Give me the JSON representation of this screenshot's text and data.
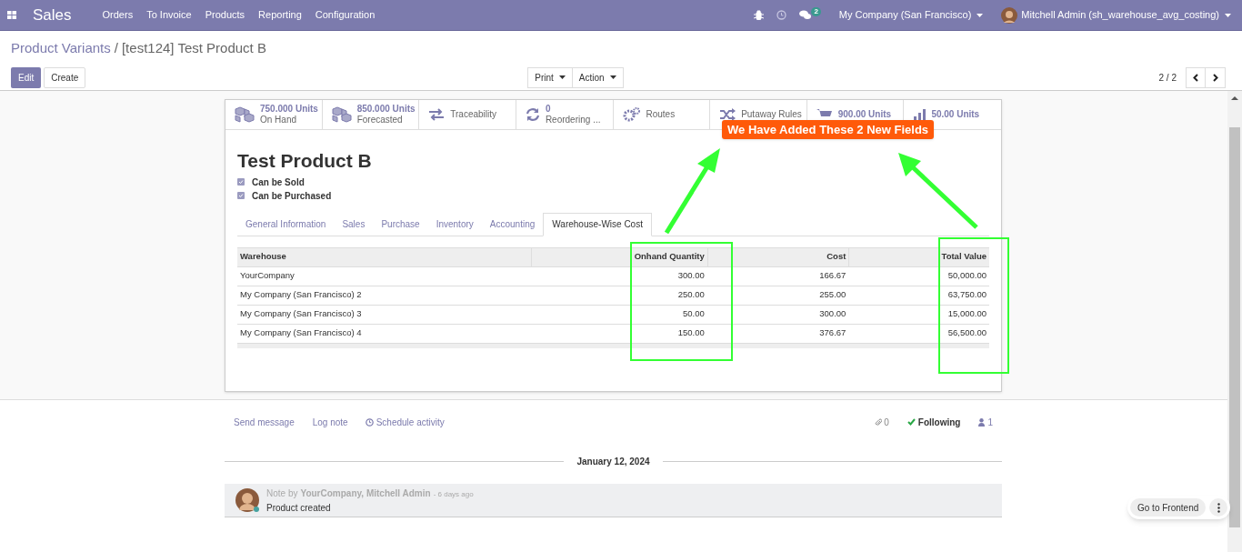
{
  "navbar": {
    "app": "Sales",
    "menu": [
      "Orders",
      "To Invoice",
      "Products",
      "Reporting",
      "Configuration"
    ],
    "messages_count": "2",
    "company": "My Company (San Francisco)",
    "user": "Mitchell Admin (sh_warehouse_avg_costing)"
  },
  "breadcrumb": {
    "parent": "Product Variants",
    "separator": "/",
    "current": "[test124] Test Product B"
  },
  "buttons": {
    "edit": "Edit",
    "create": "Create",
    "print": "Print",
    "action": "Action"
  },
  "pager": "2 / 2",
  "stat_buttons": [
    {
      "kind": "cubes",
      "value": "750.000 Units",
      "label": "On Hand"
    },
    {
      "kind": "cubes",
      "value": "850.000 Units",
      "label": "Forecasted"
    },
    {
      "kind": "exchange",
      "label": "Traceability"
    },
    {
      "kind": "refresh",
      "value": "0",
      "label": "Reordering ..."
    },
    {
      "kind": "cogs",
      "label": "Routes"
    },
    {
      "kind": "random",
      "label": "Putaway Rules"
    },
    {
      "kind": "cart",
      "value": "900.00 Units"
    },
    {
      "kind": "chart",
      "value": "50.00 Units"
    }
  ],
  "product": {
    "name": "Test Product B",
    "options": [
      {
        "label": "Can be Sold",
        "checked": true
      },
      {
        "label": "Can be Purchased",
        "checked": true
      }
    ]
  },
  "tabs": [
    {
      "label": "General Information",
      "selected": false
    },
    {
      "label": "Sales",
      "selected": false
    },
    {
      "label": "Purchase",
      "selected": false
    },
    {
      "label": "Inventory",
      "selected": false
    },
    {
      "label": "Accounting",
      "selected": false
    },
    {
      "label": "Warehouse-Wise Cost",
      "selected": true
    }
  ],
  "table": {
    "columns": [
      "Warehouse",
      "Onhand Quantity",
      "Cost",
      "Total Value"
    ],
    "rows": [
      [
        "YourCompany",
        "300.00",
        "166.67",
        "50,000.00"
      ],
      [
        "My Company (San Francisco) 2",
        "250.00",
        "255.00",
        "63,750.00"
      ],
      [
        "My Company (San Francisco) 3",
        "50.00",
        "300.00",
        "15,000.00"
      ],
      [
        "My Company (San Francisco) 4",
        "150.00",
        "376.67",
        "56,500.00"
      ]
    ]
  },
  "annotation": "We Have Added These 2 New Fields",
  "chatter": {
    "actions": [
      "Send message",
      "Log note",
      "Schedule activity"
    ],
    "attachments": "0",
    "following": "Following",
    "followers": "1",
    "date": "January 12, 2024",
    "message": {
      "prefix": "Note by",
      "author": "YourCompany, Mitchell Admin",
      "time": "- 6 days ago",
      "body": "Product created"
    }
  },
  "frontend_button": "Go to Frontend"
}
